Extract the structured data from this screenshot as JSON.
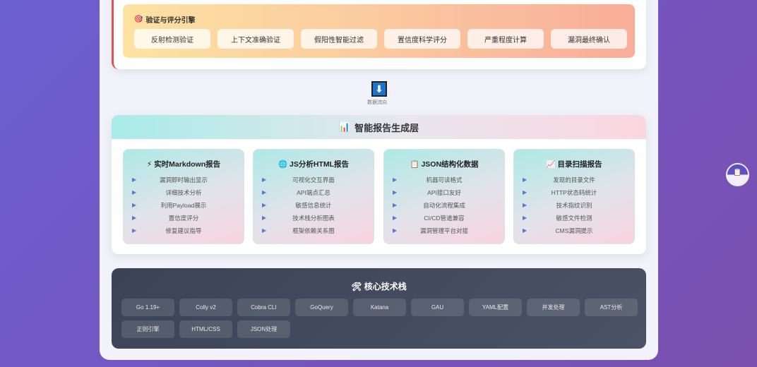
{
  "verify": {
    "icon": "🎯",
    "title": "验证与评分引擎",
    "items": [
      "反射检测验证",
      "上下文准确验证",
      "假阳性智能过滤",
      "置信度科学评分",
      "严重程度计算",
      "漏洞最终确认"
    ]
  },
  "flow": {
    "icon": "⬇",
    "label": "数据流向"
  },
  "report": {
    "icon": "📊",
    "title": "智能报告生成层",
    "cards": [
      {
        "icon": "⚡",
        "title": "实时Markdown报告",
        "items": [
          "漏洞即时输出显示",
          "详细技术分析",
          "利用Payload展示",
          "置信度评分",
          "修复建议指导"
        ]
      },
      {
        "icon": "🌐",
        "title": "JS分析HTML报告",
        "items": [
          "可视化交互界面",
          "API端点汇总",
          "敏感信息统计",
          "技术栈分析图表",
          "框架依赖关系图"
        ]
      },
      {
        "icon": "📋",
        "title": "JSON结构化数据",
        "items": [
          "机器可读格式",
          "API接口友好",
          "自动化流程集成",
          "CI/CD管道兼容",
          "漏洞管理平台对接"
        ]
      },
      {
        "icon": "📈",
        "title": "目录扫描报告",
        "items": [
          "发现的目录文件",
          "HTTP状态码统计",
          "技术指纹识别",
          "敏感文件检测",
          "CMS漏洞提示"
        ]
      }
    ]
  },
  "tech": {
    "icon": "🛠",
    "title": "核心技术栈",
    "tags": [
      "Go 1.19+",
      "Colly v2",
      "Cobra CLI",
      "GoQuery",
      "Katana",
      "GAU",
      "YAML配置",
      "并发处理",
      "AST分析",
      "正则引擎",
      "HTML/CSS",
      "JSON处理"
    ]
  },
  "fab": {
    "icon": "📋"
  }
}
